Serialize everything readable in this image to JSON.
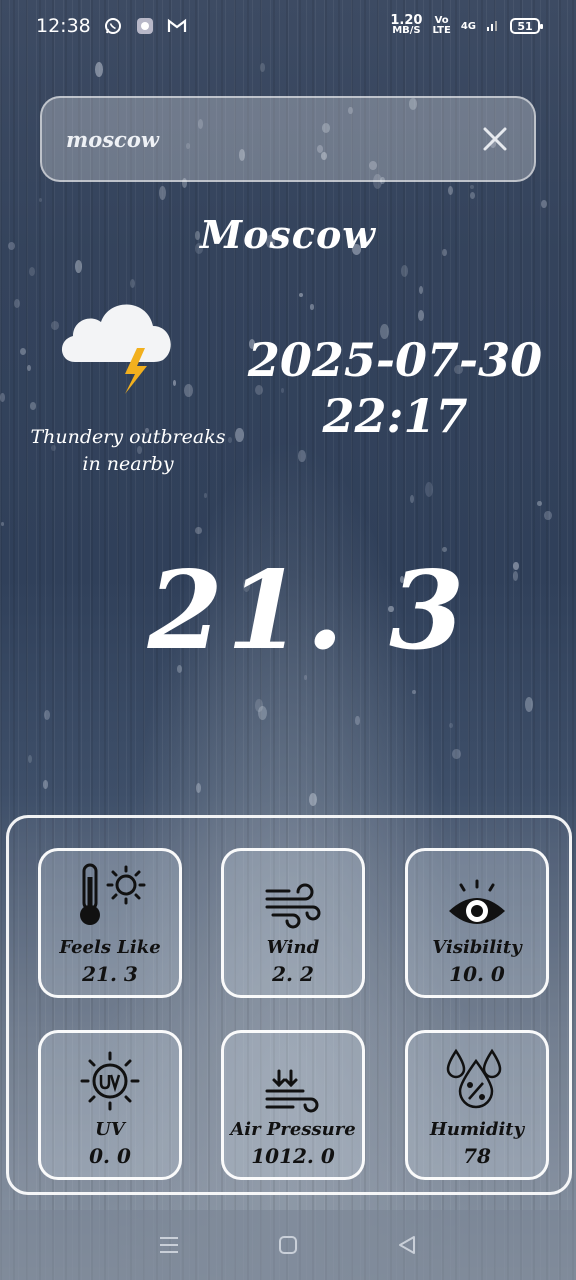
{
  "status_bar": {
    "time": "12:38",
    "net_speed_value": "1.20",
    "net_speed_unit": "MB/S",
    "volte_top": "Vo",
    "volte_bottom": "LTE",
    "network": "4G",
    "battery": "51",
    "icons": [
      "whatsapp-icon",
      "app-icon",
      "gmail-icon"
    ]
  },
  "search": {
    "value": "moscow",
    "placeholder": "moscow"
  },
  "weather": {
    "city": "Moscow",
    "condition_line1": "Thundery outbreaks",
    "condition_line2": "in nearby",
    "condition_icon": "thunder-cloud-icon",
    "date": "2025-07-30",
    "time": "22:17",
    "temperature": "21. 3"
  },
  "details": [
    {
      "label": "Feels Like",
      "value": "21. 3",
      "icon": "thermometer-sun-icon"
    },
    {
      "label": "Wind",
      "value": "2. 2",
      "icon": "wind-icon"
    },
    {
      "label": "Visibility",
      "value": "10. 0",
      "icon": "eye-icon"
    },
    {
      "label": "UV",
      "value": "0. 0",
      "icon": "uv-icon"
    },
    {
      "label": "Air Pressure",
      "value": "1012. 0",
      "icon": "pressure-icon"
    },
    {
      "label": "Humidity",
      "value": "78",
      "icon": "humidity-icon"
    }
  ],
  "colors": {
    "sky_top": "#3d4b63",
    "sky_bottom": "#8a95a4",
    "lightning": "#f2b01e",
    "card_text": "#111111"
  }
}
